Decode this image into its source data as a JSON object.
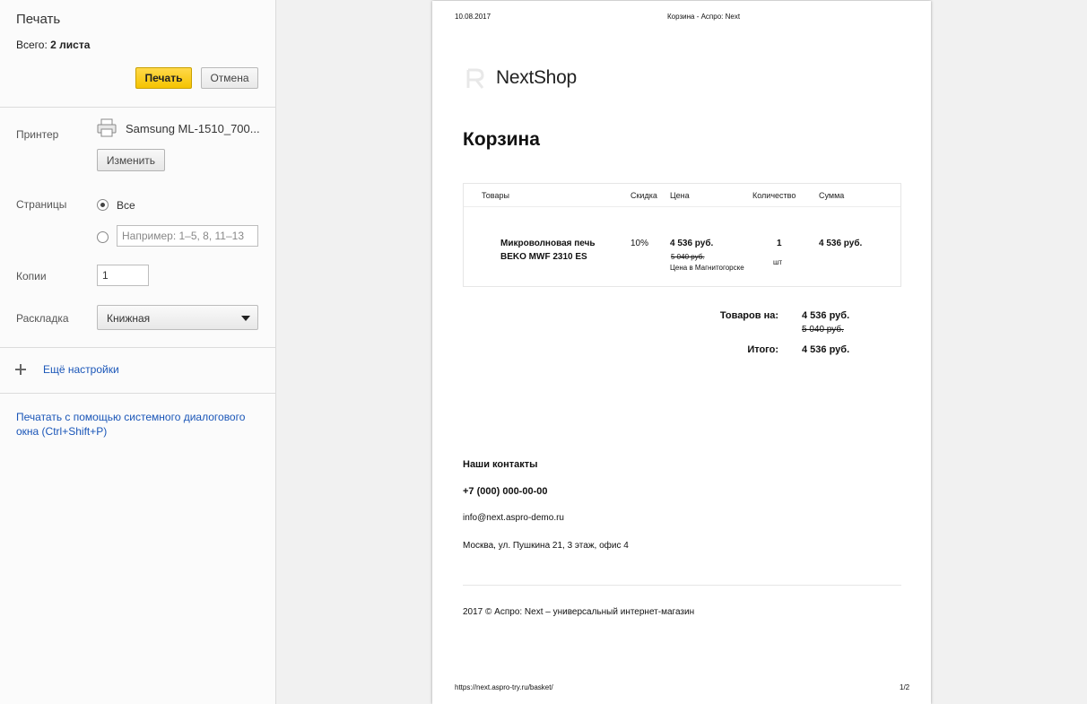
{
  "sidebar": {
    "title": "Печать",
    "total_label": "Всего:",
    "total_value": "2 листа",
    "print_button": "Печать",
    "cancel_button": "Отмена",
    "printer_label": "Принтер",
    "printer_name": "Samsung ML-1510_700...",
    "change_button": "Изменить",
    "pages_label": "Страницы",
    "pages_all": "Все",
    "pages_placeholder": "Например: 1–5, 8, 11–13",
    "copies_label": "Копии",
    "copies_value": "1",
    "layout_label": "Раскладка",
    "layout_value": "Книжная",
    "more_settings": "Ещё настройки",
    "system_dialog": "Печатать с помощью системного диалогового окна (Ctrl+Shift+P)"
  },
  "preview": {
    "header_date": "10.08.2017",
    "header_title": "Корзина - Аспро: Next",
    "logo": "NextShop",
    "heading": "Корзина",
    "columns": [
      "Товары",
      "Скидка",
      "Цена",
      "Количество",
      "Сумма"
    ],
    "item": {
      "name_line1": "Микроволновая печь",
      "name_line2": "BEKO MWF 2310 ES",
      "discount": "10%",
      "price": "4 536 руб.",
      "old_price": "5 040 руб.",
      "price_note": "Цена в Магнитогорске",
      "qty": "1",
      "unit": "шт",
      "sum": "4 536 руб."
    },
    "totals": {
      "goods_label": "Товаров на:",
      "goods_value": "4 536 руб.",
      "goods_old": "5 040 руб.",
      "total_label": "Итого:",
      "total_value": "4 536 руб."
    },
    "contacts_heading": "Наши контакты",
    "phone": "+7 (000) 000-00-00",
    "email": "info@next.aspro-demo.ru",
    "address": "Москва, ул. Пушкина 21, 3 этаж, офис 4",
    "copyright": "2017 © Аспро: Next – универсальный интернет-магазин",
    "footer_url": "https://next.aspro-try.ru/basket/",
    "footer_page": "1/2"
  },
  "colors": {
    "print_button": "#f5c400",
    "link": "#1a56b8",
    "background": "#f1f1f1"
  }
}
